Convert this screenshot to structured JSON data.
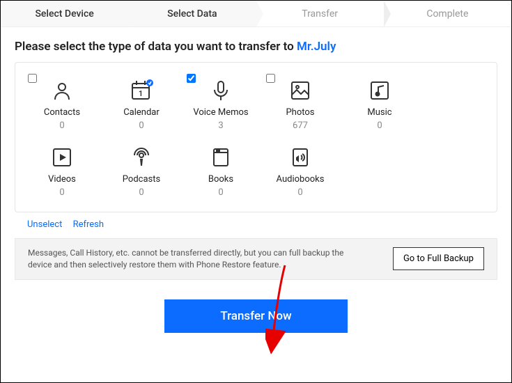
{
  "steps": {
    "select_device": "Select Device",
    "select_data": "Select Data",
    "transfer": "Transfer",
    "complete": "Complete"
  },
  "prompt_prefix": "Please select the type of data you want to transfer to ",
  "device_name": "Mr.July",
  "items": [
    {
      "key": "contacts",
      "label": "Contacts",
      "count": "0",
      "checked": false,
      "showCheckbox": true
    },
    {
      "key": "calendar",
      "label": "Calendar",
      "count": "0",
      "checked": false,
      "showCheckbox": false
    },
    {
      "key": "voice-memos",
      "label": "Voice Memos",
      "count": "3",
      "checked": true,
      "showCheckbox": true
    },
    {
      "key": "photos",
      "label": "Photos",
      "count": "677",
      "checked": false,
      "showCheckbox": true
    },
    {
      "key": "music",
      "label": "Music",
      "count": "0",
      "checked": false,
      "showCheckbox": false
    },
    {
      "key": "videos",
      "label": "Videos",
      "count": "0",
      "checked": false,
      "showCheckbox": false
    },
    {
      "key": "podcasts",
      "label": "Podcasts",
      "count": "0",
      "checked": false,
      "showCheckbox": false
    },
    {
      "key": "books",
      "label": "Books",
      "count": "0",
      "checked": false,
      "showCheckbox": false
    },
    {
      "key": "audiobooks",
      "label": "Audiobooks",
      "count": "0",
      "checked": false,
      "showCheckbox": false
    }
  ],
  "links": {
    "unselect": "Unselect",
    "refresh": "Refresh"
  },
  "notice_msg": "Messages, Call History, etc. cannot be transferred directly, but you can full backup the device and then selectively restore them with Phone Restore feature.",
  "full_backup_btn": "Go to Full Backup",
  "transfer_btn": "Transfer Now",
  "colors": {
    "accent": "#0b6cff"
  }
}
